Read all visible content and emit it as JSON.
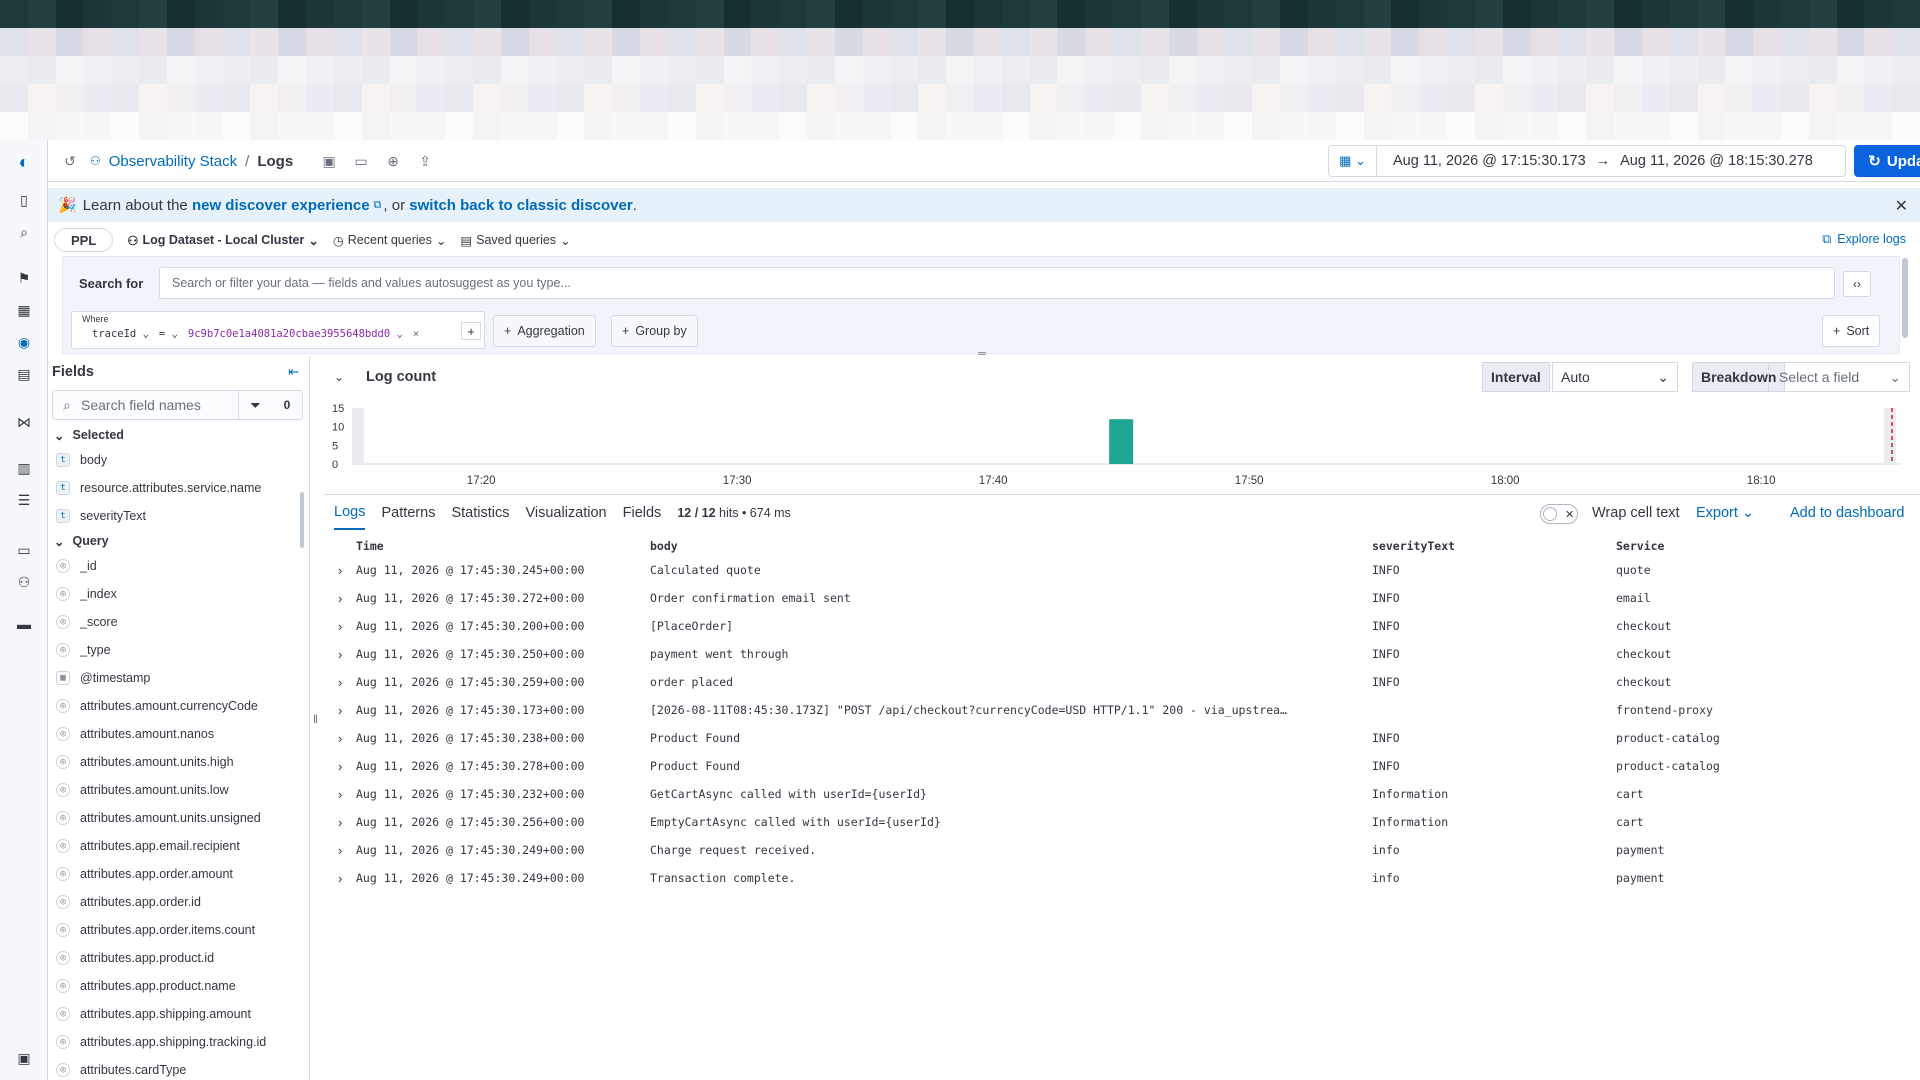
{
  "breadcrumbs": {
    "workspace": "Observability Stack",
    "separator": "/",
    "current": "Logs"
  },
  "datepicker": {
    "start": "Aug 11, 2026 @ 17:15:30.173",
    "arrow": "→",
    "end": "Aug 11, 2026 @ 18:15:30.278"
  },
  "update_label": "Update",
  "banner": {
    "prefix": "Learn about the",
    "link1": "new discover experience",
    "mid": ", or",
    "link2": "switch back to classic discover",
    "suffix": "."
  },
  "query_bar": {
    "language": "PPL",
    "dataset": "Log Dataset - Local Cluster",
    "recent": "Recent queries",
    "saved": "Saved queries",
    "explore": "Explore logs"
  },
  "search": {
    "label": "Search for",
    "placeholder": "Search or filter your data — fields and values autosuggest as you type..."
  },
  "where": {
    "label": "Where",
    "field": "traceId",
    "op": "=",
    "value": "9c9b7c0e1a4081a20cbae3955648bdd0"
  },
  "pills": {
    "aggregation": "Aggregation",
    "group_by": "Group by",
    "sort": "Sort"
  },
  "sidebar": {
    "title": "Fields",
    "search_placeholder": "Search field names",
    "filter_count": "0",
    "selected_label": "Selected",
    "selected": [
      {
        "type": "t",
        "name": "body"
      },
      {
        "type": "t",
        "name": "resource.attributes.service.name"
      },
      {
        "type": "t",
        "name": "severityText"
      }
    ],
    "query_label": "Query",
    "query": [
      {
        "type": "num",
        "name": "_id"
      },
      {
        "type": "num",
        "name": "_index"
      },
      {
        "type": "num",
        "name": "_score"
      },
      {
        "type": "num",
        "name": "_type"
      },
      {
        "type": "date",
        "name": "@timestamp"
      },
      {
        "type": "num",
        "name": "attributes.amount.currencyCode"
      },
      {
        "type": "num",
        "name": "attributes.amount.nanos"
      },
      {
        "type": "num",
        "name": "attributes.amount.units.high"
      },
      {
        "type": "num",
        "name": "attributes.amount.units.low"
      },
      {
        "type": "num",
        "name": "attributes.amount.units.unsigned"
      },
      {
        "type": "num",
        "name": "attributes.app.email.recipient"
      },
      {
        "type": "num",
        "name": "attributes.app.order.amount"
      },
      {
        "type": "num",
        "name": "attributes.app.order.id"
      },
      {
        "type": "num",
        "name": "attributes.app.order.items.count"
      },
      {
        "type": "num",
        "name": "attributes.app.product.id"
      },
      {
        "type": "num",
        "name": "attributes.app.product.name"
      },
      {
        "type": "num",
        "name": "attributes.app.shipping.amount"
      },
      {
        "type": "num",
        "name": "attributes.app.shipping.tracking.id"
      },
      {
        "type": "num",
        "name": "attributes.cardType"
      }
    ]
  },
  "histogram": {
    "title": "Log count",
    "interval_label": "Interval",
    "interval_value": "Auto",
    "breakdown_label": "Breakdown",
    "breakdown_placeholder": "Select a field"
  },
  "chart_data": {
    "type": "bar",
    "title": "Log count",
    "yticks": [
      "15",
      "10",
      "5",
      "0"
    ],
    "ylim": [
      0,
      15
    ],
    "xticks": [
      "17:20",
      "17:30",
      "17:40",
      "17:50",
      "18:00",
      "18:10"
    ],
    "bars": [
      {
        "x": "17:45",
        "value": 12
      }
    ]
  },
  "tabs": [
    "Logs",
    "Patterns",
    "Statistics",
    "Visualization",
    "Fields"
  ],
  "hits": "12 / 12 hits • 674 ms",
  "hits_count": "12 / 12",
  "hits_rest": "hits • 674 ms",
  "wrap_label": "Wrap cell text",
  "export_label": "Export",
  "add_dashboard_label": "Add to dashboard",
  "table": {
    "columns": [
      "Time",
      "body",
      "severityText",
      "Service"
    ],
    "rows": [
      [
        "Aug 11, 2026 @ 17:45:30.245+00:00",
        "Calculated quote",
        "INFO",
        "quote"
      ],
      [
        "Aug 11, 2026 @ 17:45:30.272+00:00",
        "Order confirmation email sent",
        "INFO",
        "email"
      ],
      [
        "Aug 11, 2026 @ 17:45:30.200+00:00",
        "[PlaceOrder]",
        "INFO",
        "checkout"
      ],
      [
        "Aug 11, 2026 @ 17:45:30.250+00:00",
        "payment went through",
        "INFO",
        "checkout"
      ],
      [
        "Aug 11, 2026 @ 17:45:30.259+00:00",
        "order placed",
        "INFO",
        "checkout"
      ],
      [
        "Aug 11, 2026 @ 17:45:30.173+00:00",
        "[2026-08-11T08:45:30.173Z] \"POST /api/checkout?currencyCode=USD HTTP/1.1\" 200 - via_upstrea…",
        "",
        "frontend-proxy"
      ],
      [
        "Aug 11, 2026 @ 17:45:30.238+00:00",
        "Product Found",
        "INFO",
        "product-catalog"
      ],
      [
        "Aug 11, 2026 @ 17:45:30.278+00:00",
        "Product Found",
        "INFO",
        "product-catalog"
      ],
      [
        "Aug 11, 2026 @ 17:45:30.232+00:00",
        "GetCartAsync called with userId={userId}",
        "Information",
        "cart"
      ],
      [
        "Aug 11, 2026 @ 17:45:30.256+00:00",
        "EmptyCartAsync called with userId={userId}",
        "Information",
        "cart"
      ],
      [
        "Aug 11, 2026 @ 17:45:30.249+00:00",
        "Charge request received.",
        "info",
        "payment"
      ],
      [
        "Aug 11, 2026 @ 17:45:30.249+00:00",
        "Transaction complete.",
        "info",
        "payment"
      ]
    ]
  },
  "colors": {
    "accent": "#006bb8",
    "primary_button": "#0b64dd",
    "bar": "#1ea593",
    "banner_bg": "#e6f1fa",
    "marker": "#bd271e"
  }
}
